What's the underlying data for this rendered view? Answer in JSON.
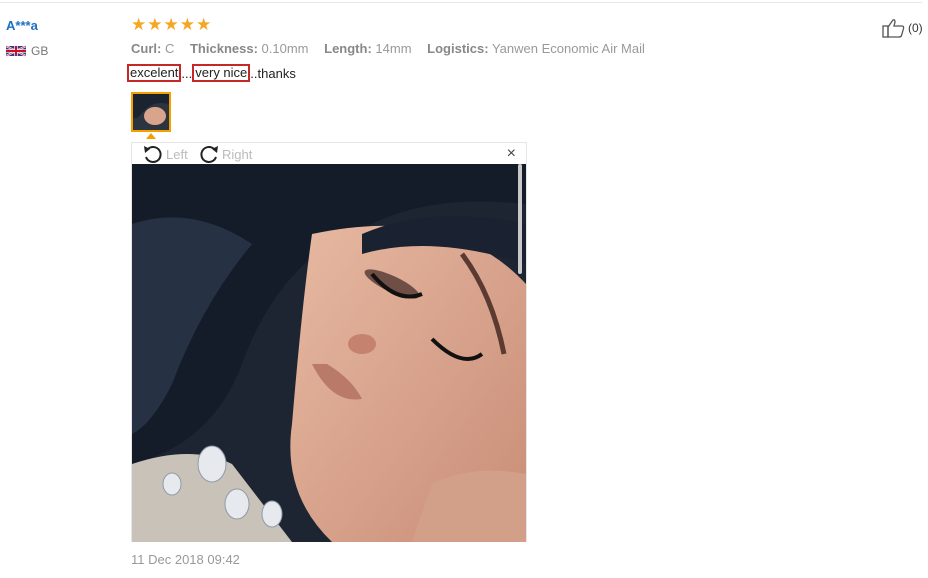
{
  "reviewer": {
    "name": "A***a",
    "country": "GB"
  },
  "rating": {
    "stars": 5
  },
  "attributes": [
    {
      "key": "Curl:",
      "value": "C"
    },
    {
      "key": "Thickness:",
      "value": "0.10mm"
    },
    {
      "key": "Length:",
      "value": "14mm"
    },
    {
      "key": "Logistics:",
      "value": "Yanwen Economic Air Mail"
    }
  ],
  "review": {
    "part1": "excelent",
    "sep1": "...",
    "part2": "very nice",
    "sep2": "..thanks"
  },
  "viewer": {
    "rotate_left": "Left",
    "rotate_right": "Right",
    "close": "×"
  },
  "date": "11 Dec 2018 09:42",
  "helpful": {
    "count": "(0)"
  },
  "colors": {
    "star": "#f5a623",
    "link": "#1f6fc5",
    "highlight_border": "#c62828",
    "thumb_border": "#f4a100"
  }
}
